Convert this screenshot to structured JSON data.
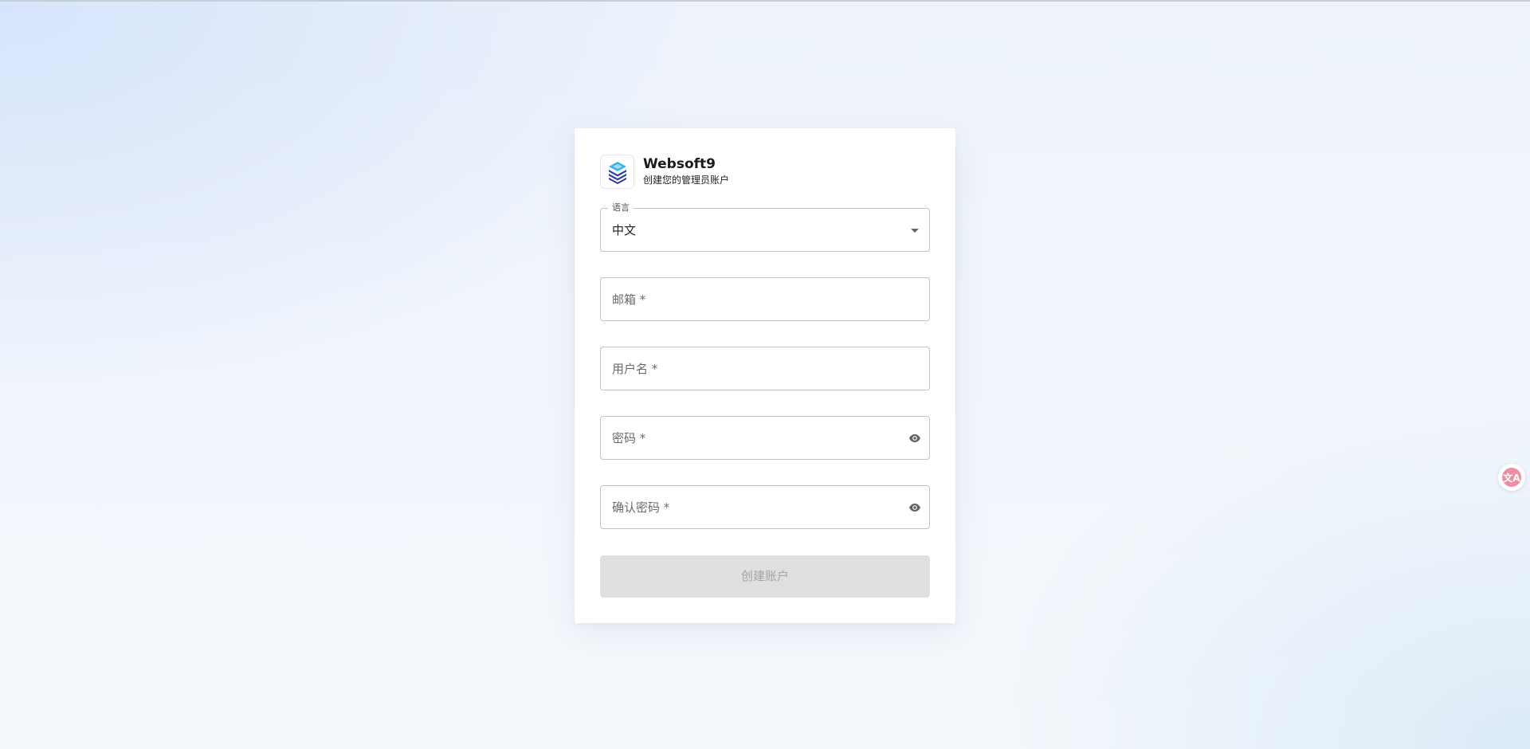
{
  "brand": {
    "title": "Websoft9",
    "subtitle": "创建您的管理员账户",
    "logo_icon": "layered-box-logo-icon"
  },
  "form": {
    "language": {
      "label": "语言",
      "value": "中文",
      "options_visible": [
        "中文"
      ]
    },
    "email": {
      "placeholder": "邮箱 *"
    },
    "username": {
      "placeholder": "用户名 *"
    },
    "password": {
      "placeholder": "密码 *",
      "toggle_icon": "eye-icon"
    },
    "confirm_password": {
      "placeholder": "确认密码 *",
      "toggle_icon": "eye-icon"
    },
    "submit_label": "创建账户"
  },
  "translate_widget": {
    "icon": "translate-icon",
    "glyph": "文A"
  },
  "colors": {
    "logo_blue": "#2b3fb0",
    "logo_cyan": "#36b6e6",
    "button_disabled_bg": "#e0e0e0",
    "button_disabled_text": "#a3a3a3",
    "translate_pink": "#ec8fa3"
  }
}
